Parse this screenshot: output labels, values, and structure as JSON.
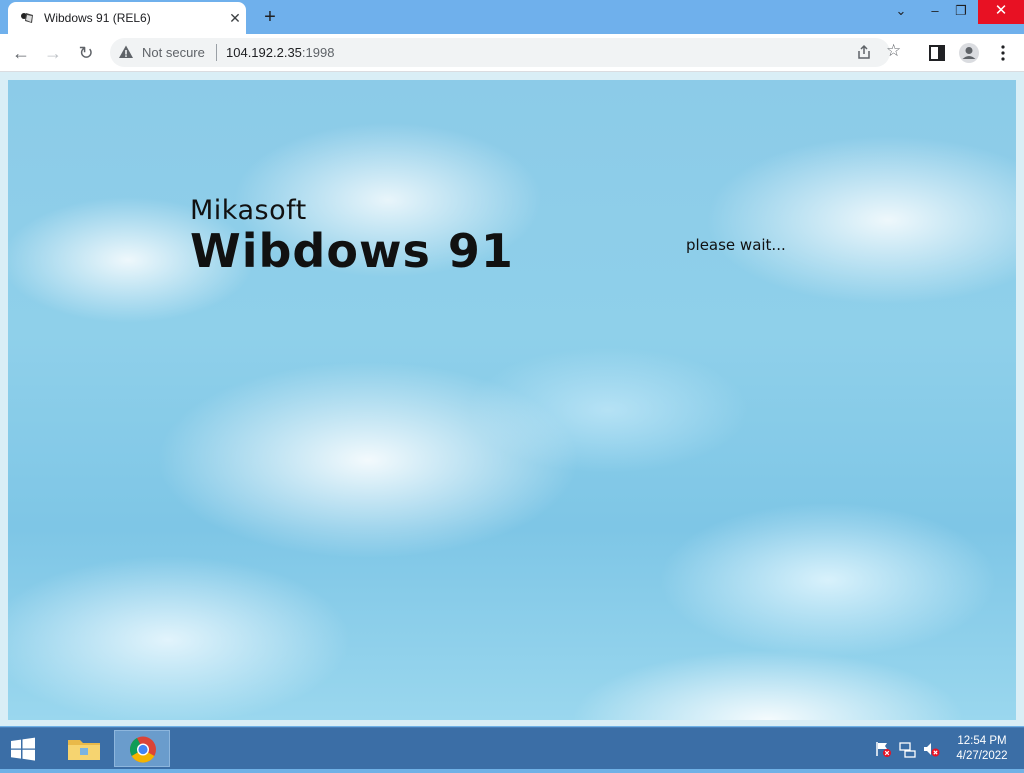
{
  "browser": {
    "tab": {
      "title": "Wibdows 91 (REL6)",
      "close_glyph": "✕",
      "favicon": "wibdows-icon"
    },
    "new_tab_glyph": "+",
    "window_buttons": {
      "dropdown": "⌄",
      "minimize": "–",
      "maximize": "❐",
      "close": "✕"
    },
    "nav": {
      "back": "←",
      "forward": "→",
      "reload": "↻"
    },
    "omnibox": {
      "security": "Not secure",
      "host": "104.192.2.35",
      "port": ":1998"
    }
  },
  "page": {
    "brand_small": "Mikasoft",
    "brand_big": "Wibdows 91",
    "status": "please wait..."
  },
  "taskbar": {
    "clock_time": "12:54 PM",
    "clock_date": "4/27/2022",
    "apps": [
      "file-explorer-icon",
      "chrome-icon"
    ]
  },
  "colors": {
    "tabstrip": "#6fb0ec",
    "taskbar": "#3b6ea6",
    "close_red": "#e81123"
  }
}
